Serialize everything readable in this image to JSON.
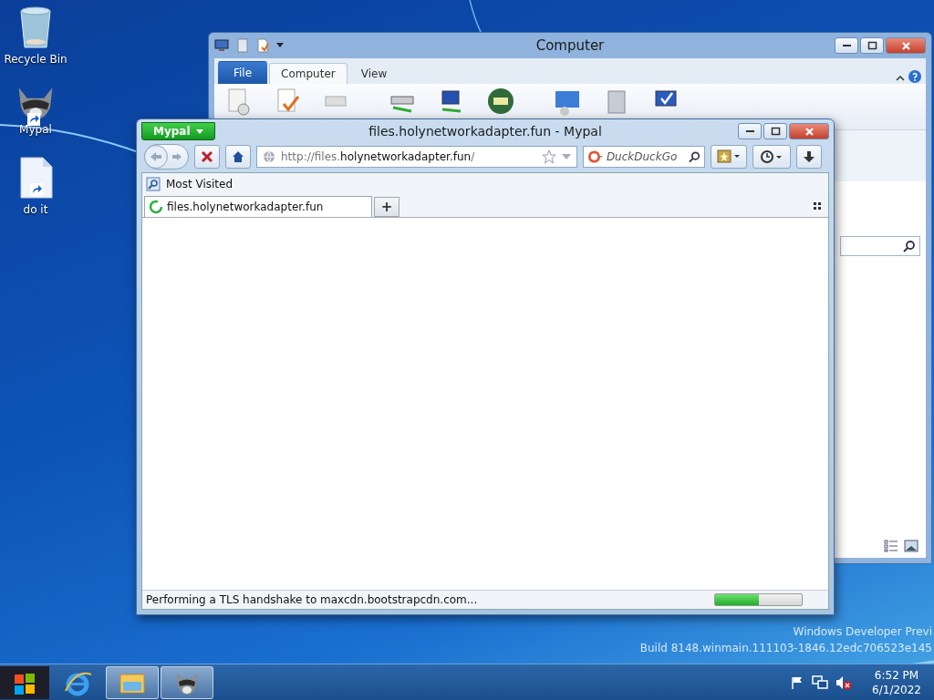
{
  "desktop_icons": [
    {
      "label": "Recycle Bin",
      "kind": "bin",
      "shortcut": false
    },
    {
      "label": "Mypal",
      "kind": "raccoon",
      "shortcut": true
    },
    {
      "label": "do it",
      "kind": "file",
      "shortcut": true
    }
  ],
  "explorer_window": {
    "title": "Computer",
    "ribbon_tabs": [
      {
        "label": "File",
        "kind": "file",
        "selected": false
      },
      {
        "label": "Computer",
        "kind": "tab",
        "selected": true
      },
      {
        "label": "View",
        "kind": "tab",
        "selected": false
      }
    ]
  },
  "browser_window": {
    "menu_button": "Mypal",
    "title": "files.holynetworkadapter.fun - Mypal",
    "address": {
      "scheme": "http://files.",
      "host": "holynetworkadapter.fun",
      "path": "/"
    },
    "search": {
      "placeholder": "DuckDuckGo"
    },
    "bookmarks": [
      "Most Visited"
    ],
    "tabs": [
      {
        "label": "files.holynetworkadapter.fun",
        "selected": true,
        "loading": true
      }
    ],
    "new_tab": "+",
    "status": "Performing a TLS handshake to maxcdn.bootstrapcdn.com...",
    "progress": {
      "level": 0.5
    }
  },
  "watermark": [
    "Windows Developer Previ",
    "Build 8148.winmain.111103-1846.12edc706523e145"
  ],
  "taskbar": {
    "items": [
      {
        "kind": "start",
        "running": false
      },
      {
        "kind": "ie",
        "running": false
      },
      {
        "kind": "explorer",
        "running": true
      },
      {
        "kind": "raccoon",
        "running": true
      }
    ],
    "clock": {
      "time": "6:52 PM",
      "date": "6/1/2022"
    }
  }
}
